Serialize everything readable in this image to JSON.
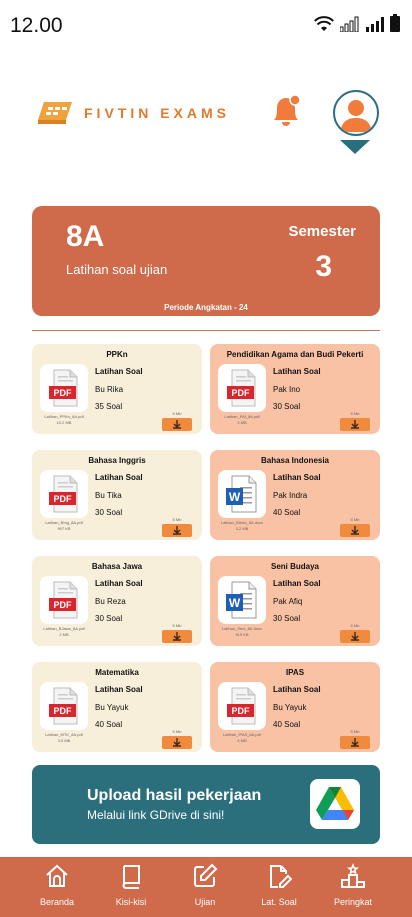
{
  "status": {
    "time": "12.00"
  },
  "app": {
    "brand": "FIVTIN EXAMS"
  },
  "semester_card": {
    "class_name": "8A",
    "subtitle": "Latihan soal ujian",
    "semester_label": "Semester",
    "semester_number": "3",
    "period": "Periode Angkatan - 24"
  },
  "subjects": [
    {
      "title": "PPKn",
      "type": "PDF",
      "kind": "Latihan Soal",
      "teacher": "Bu Rika",
      "count": "35 Soal",
      "file_name": "Latihan_PPKn_8A.pdf",
      "file_size": "10.2 MB",
      "dl_size": "5 Mb"
    },
    {
      "title": "Pendidikan Agama  dan Budi Pekerti",
      "type": "PDF",
      "kind": "Latihan Soal",
      "teacher": "Pak Ino",
      "count": "30 Soal",
      "file_name": "Latihan_PAI_8A.pdf",
      "file_size": "2 MB",
      "dl_size": "5 Mb"
    },
    {
      "title": "Bahasa Inggris",
      "type": "PDF",
      "kind": "Latihan Soal",
      "teacher": "Bu Tika",
      "count": "30 Soal",
      "file_name": "Latihan_BIng_8A.pdf",
      "file_size": "997 KB",
      "dl_size": "5 Mb"
    },
    {
      "title": "Bahasa Indonesia",
      "type": "DOC",
      "kind": "Latihan Soal",
      "teacher": "Pak Indra",
      "count": "40 Soal",
      "file_name": "Latihan_BIndo_8A.docx",
      "file_size": "3.2 MB",
      "dl_size": "5 Mb"
    },
    {
      "title": "Bahasa Jawa",
      "type": "PDF",
      "kind": "Latihan Soal",
      "teacher": "Bu Reza",
      "count": "30 Soal",
      "file_name": "Latihan_BJawa_8A.pdf",
      "file_size": "2 MB",
      "dl_size": "5 Mb"
    },
    {
      "title": "Seni Budaya",
      "type": "DOC",
      "kind": "Latihan Soal",
      "teacher": "Pak Afiq",
      "count": "30 Soal",
      "file_name": "Latihan_Seni_8A.docx",
      "file_size": "919 KB",
      "dl_size": "5 Mb"
    },
    {
      "title": "Matematika",
      "type": "PDF",
      "kind": "Latihan Soal",
      "teacher": "Bu Yayuk",
      "count": "40 Soal",
      "file_name": "Latihan_MTK_8A.pdf",
      "file_size": "3.5 MB",
      "dl_size": "5 Mb"
    },
    {
      "title": "IPAS",
      "type": "PDF",
      "kind": "Latihan Soal",
      "teacher": "Bu Yayuk",
      "count": "40 Soal",
      "file_name": "Latihan_IPAS_8A.pdf",
      "file_size": "4 MB",
      "dl_size": "5 Mb"
    }
  ],
  "upload": {
    "title": "Upload hasil pekerjaan",
    "subtitle": "Melalui link GDrive di sini!"
  },
  "nav": [
    {
      "label": "Beranda",
      "icon": "home-icon"
    },
    {
      "label": "Kisi-kisi",
      "icon": "book-icon"
    },
    {
      "label": "Ujian",
      "icon": "edit-icon"
    },
    {
      "label": "Lat. Soal",
      "icon": "document-edit-icon"
    },
    {
      "label": "Peringkat",
      "icon": "podium-icon"
    }
  ],
  "colors": {
    "primary": "#cf6a4a",
    "teal": "#2b6f7d",
    "cream": "#f8efda",
    "peach": "#f9c2a5",
    "accent": "#f08a3c"
  }
}
